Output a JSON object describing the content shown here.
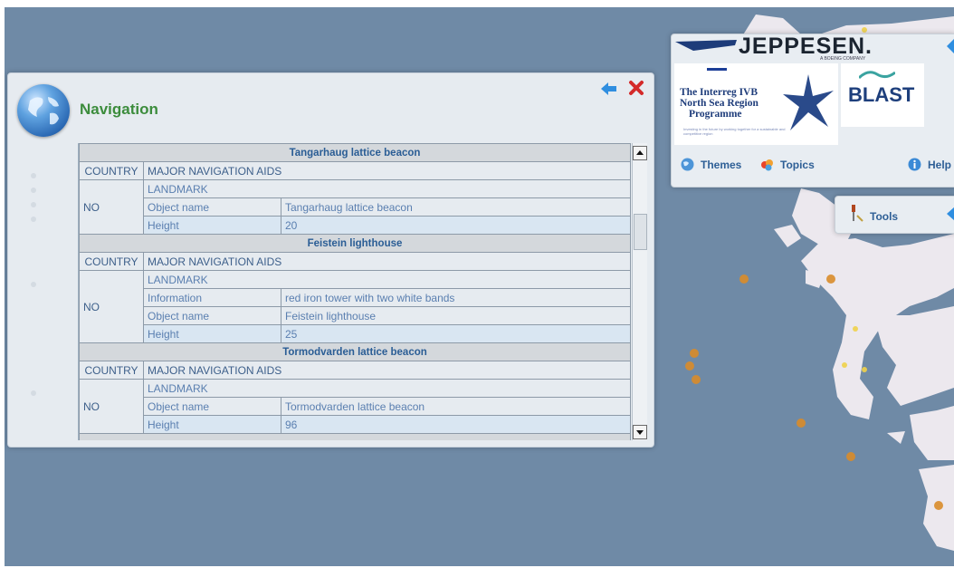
{
  "navigation_panel": {
    "title": "Navigation",
    "header_icon": "globe-icon",
    "back_icon": "arrow-left-icon",
    "close_icon": "close-icon",
    "sections": [
      {
        "heading": "Tangarhaug lattice beacon",
        "country_label": "COUNTRY",
        "category": "MAJOR NAVIGATION AIDS",
        "country_value": "NO",
        "type": "LANDMARK",
        "rows": [
          {
            "attr": "Object name",
            "value": "Tangarhaug lattice beacon"
          },
          {
            "attr": "Height",
            "value": "20"
          }
        ]
      },
      {
        "heading": "Feistein lighthouse",
        "country_label": "COUNTRY",
        "category": "MAJOR NAVIGATION AIDS",
        "country_value": "NO",
        "type": "LANDMARK",
        "rows": [
          {
            "attr": "Information",
            "value": "red iron tower with two white bands"
          },
          {
            "attr": "Object name",
            "value": "Feistein lighthouse"
          },
          {
            "attr": "Height",
            "value": "25"
          }
        ]
      },
      {
        "heading": "Tormodvarden lattice beacon",
        "country_label": "COUNTRY",
        "category": "MAJOR NAVIGATION AIDS",
        "country_value": "NO",
        "type": "LANDMARK",
        "rows": [
          {
            "attr": "Object name",
            "value": "Tormodvarden lattice beacon"
          },
          {
            "attr": "Height",
            "value": "96"
          }
        ]
      }
    ]
  },
  "brand_panel": {
    "jeppesen": "JEPPESEN.",
    "jeppesen_sub": "A BOEING COMPANY",
    "interreg_lines": [
      "The Interreg IVB",
      "North Sea Region",
      "Programme"
    ],
    "interreg_small": "Investing in the future by working together for a sustainable and competitive region",
    "blast": "BLAST",
    "menu": {
      "themes": "Themes",
      "topics": "Topics",
      "help": "Help"
    }
  },
  "tools_panel": {
    "label": "Tools"
  },
  "colors": {
    "sea": "#6f8aa6",
    "land": "#ece8ee",
    "title_green": "#3c8c3c",
    "link_blue": "#2e5f96",
    "marker_orange": "#d98c2a"
  }
}
